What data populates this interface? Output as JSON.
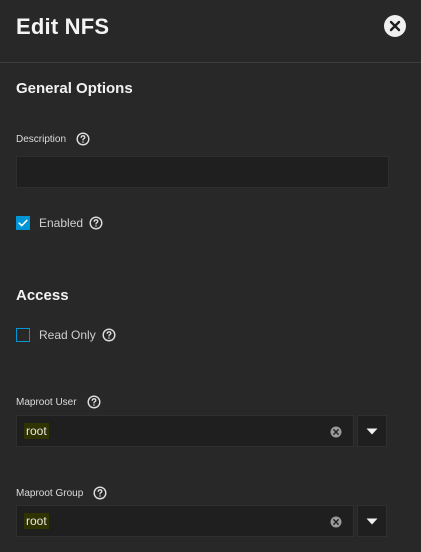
{
  "dialog": {
    "title": "Edit NFS",
    "close_icon": "close-circle-icon"
  },
  "general_options": {
    "heading": "General Options",
    "description": {
      "label": "Description",
      "value": "",
      "placeholder": "",
      "help_icon": "help-circle-icon"
    },
    "enabled": {
      "label": "Enabled",
      "checked": true,
      "help_icon": "help-circle-icon"
    }
  },
  "access": {
    "heading": "Access",
    "read_only": {
      "label": "Read Only",
      "checked": false,
      "help_icon": "help-circle-icon"
    },
    "maproot_user": {
      "label": "Maproot User",
      "value": "root",
      "help_icon": "help-circle-icon",
      "clear_icon": "clear-icon",
      "dropdown_icon": "caret-down-icon"
    },
    "maproot_group": {
      "label": "Maproot Group",
      "value": "root",
      "help_icon": "help-circle-icon",
      "clear_icon": "clear-icon",
      "dropdown_icon": "caret-down-icon"
    }
  },
  "colors": {
    "background": "#282828",
    "input_background": "#1f1f1f",
    "accent": "#0095d5",
    "text": "#e6e6e6"
  }
}
